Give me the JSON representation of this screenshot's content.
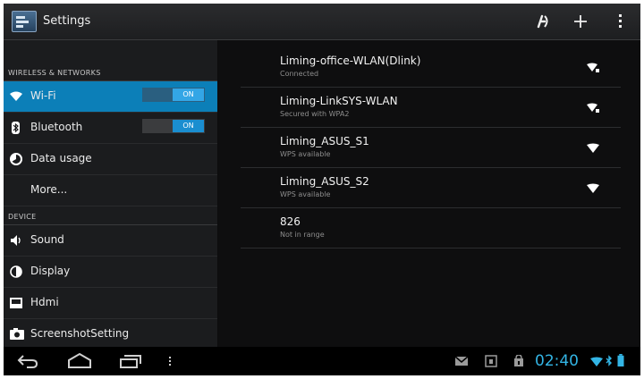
{
  "actionbar": {
    "title": "Settings"
  },
  "sidebar": {
    "sections": [
      {
        "header": "WIRELESS & NETWORKS"
      },
      {
        "header": "DEVICE"
      }
    ],
    "items": [
      {
        "label": "Wi-Fi",
        "icon": "wifi-icon",
        "selected": true,
        "toggle": "ON"
      },
      {
        "label": "Bluetooth",
        "icon": "bluetooth-icon",
        "toggle": "ON"
      },
      {
        "label": "Data usage",
        "icon": "data-usage-icon"
      },
      {
        "label": "More..."
      },
      {
        "label": "Sound",
        "icon": "speaker-icon"
      },
      {
        "label": "Display",
        "icon": "display-icon"
      },
      {
        "label": "Hdmi",
        "icon": "hdmi-icon"
      },
      {
        "label": "ScreenshotSetting",
        "icon": "camera-icon"
      }
    ]
  },
  "networks": [
    {
      "name": "Liming-office-WLAN(Dlink)",
      "status": "Connected",
      "secured": true
    },
    {
      "name": "Liming-LinkSYS-WLAN",
      "status": "Secured with WPA2",
      "secured": true
    },
    {
      "name": "Liming_ASUS_S1",
      "status": "WPS available",
      "secured": false
    },
    {
      "name": "Liming_ASUS_S2",
      "status": "WPS available",
      "secured": false
    },
    {
      "name": "826",
      "status": "Not in range",
      "secured": false
    }
  ],
  "statusbar": {
    "time": "02:40"
  },
  "colors": {
    "accent": "#33b5e5",
    "selected": "#0c7fb8"
  }
}
